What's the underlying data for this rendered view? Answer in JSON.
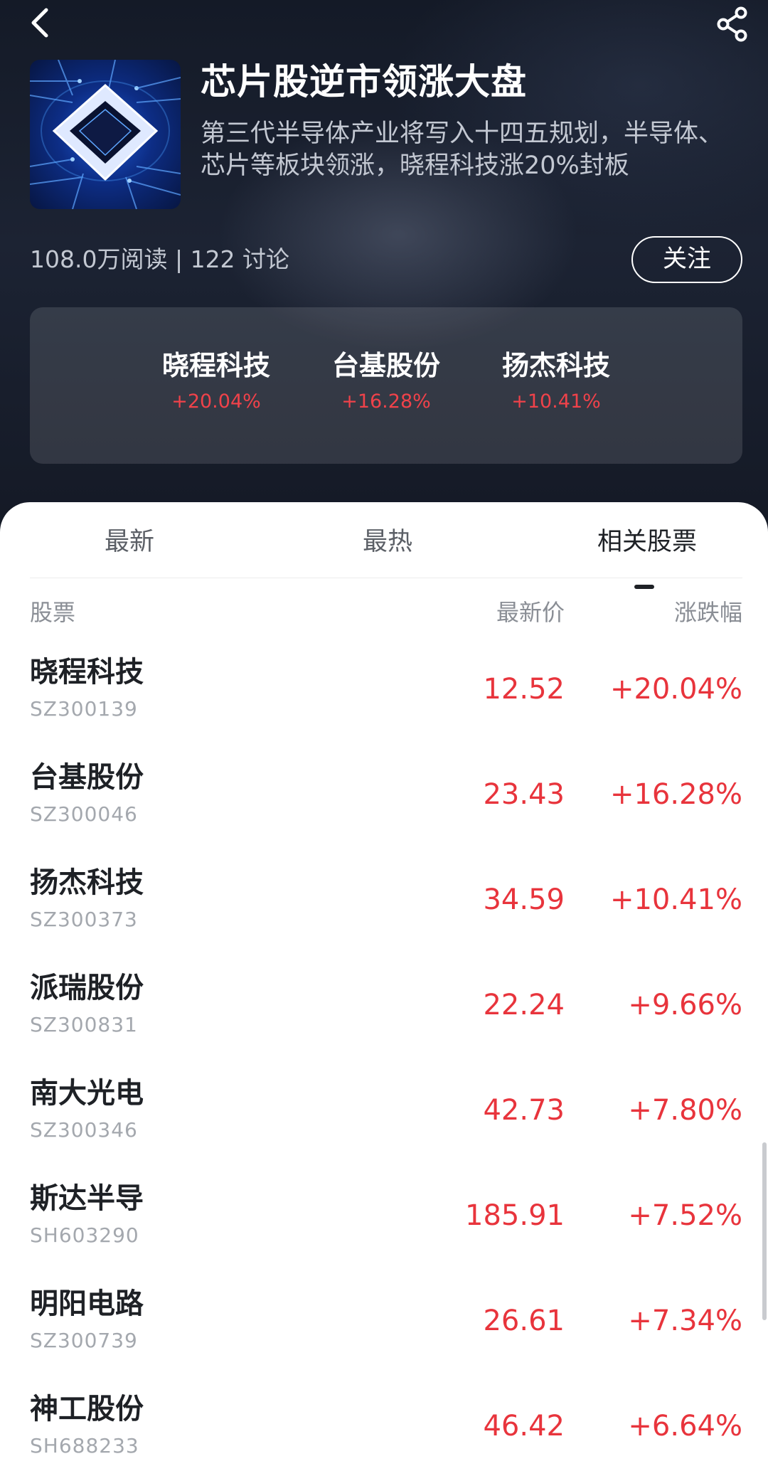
{
  "header": {
    "back_icon": "chevron-left-icon",
    "share_icon": "share-icon"
  },
  "topic": {
    "title": "芯片股逆市领涨大盘",
    "description": "第三代半导体产业将写入十四五规划，半导体、芯片等板块领涨，晓程科技涨20%封板",
    "stats": "108.0万阅读 | 122 讨论",
    "follow_label": "关注"
  },
  "leaders": [
    {
      "name": "晓程科技",
      "change": "+20.04%"
    },
    {
      "name": "台基股份",
      "change": "+16.28%"
    },
    {
      "name": "扬杰科技",
      "change": "+10.41%"
    }
  ],
  "tabs": [
    {
      "label": "最新"
    },
    {
      "label": "最热"
    },
    {
      "label": "相关股票"
    }
  ],
  "active_tab": 2,
  "table": {
    "columns": {
      "stock": "股票",
      "price": "最新价",
      "change": "涨跌幅"
    },
    "rows": [
      {
        "name": "晓程科技",
        "code": "SZ300139",
        "price": "12.52",
        "change": "+20.04%"
      },
      {
        "name": "台基股份",
        "code": "SZ300046",
        "price": "23.43",
        "change": "+16.28%"
      },
      {
        "name": "扬杰科技",
        "code": "SZ300373",
        "price": "34.59",
        "change": "+10.41%"
      },
      {
        "name": "派瑞股份",
        "code": "SZ300831",
        "price": "22.24",
        "change": "+9.66%"
      },
      {
        "name": "南大光电",
        "code": "SZ300346",
        "price": "42.73",
        "change": "+7.80%"
      },
      {
        "name": "斯达半导",
        "code": "SH603290",
        "price": "185.91",
        "change": "+7.52%"
      },
      {
        "name": "明阳电路",
        "code": "SZ300739",
        "price": "26.61",
        "change": "+7.34%"
      },
      {
        "name": "神工股份",
        "code": "SH688233",
        "price": "46.42",
        "change": "+6.64%"
      }
    ]
  },
  "colors": {
    "up_red": "#e8343c",
    "hero_bg": "#1c2333",
    "text_primary": "#1e2126",
    "text_muted": "#8a8e95"
  }
}
